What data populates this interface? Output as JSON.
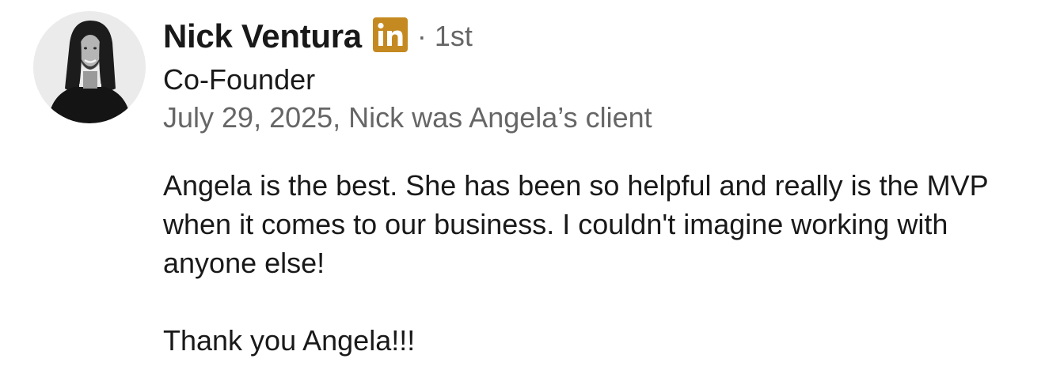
{
  "recommendation": {
    "author_name": "Nick Ventura",
    "linkedin_badge": "linkedin-icon",
    "connection_degree": "· 1st",
    "headline": "Co-Founder",
    "meta": "July 29, 2025, Nick was Angela’s client",
    "body": [
      "Angela is the best. She has been so helpful and really is the MVP when it comes to our business. I couldn't imagine working with anyone else!",
      "Thank you Angela!!!"
    ]
  },
  "colors": {
    "linkedin_badge": "#c48a21",
    "muted_text": "#666666",
    "primary_text": "#191919"
  }
}
